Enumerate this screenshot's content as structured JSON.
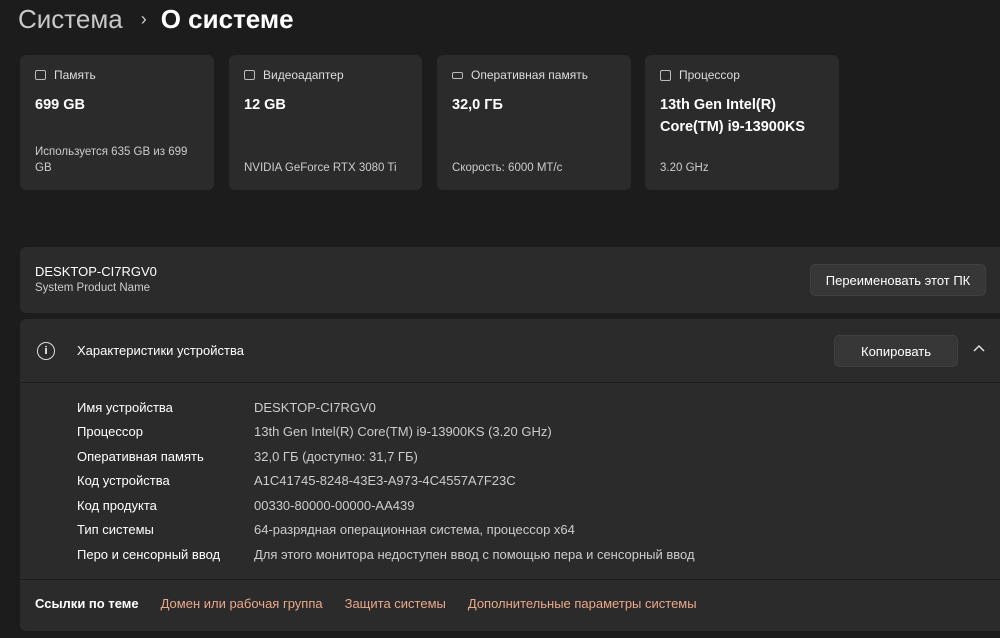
{
  "breadcrumb": {
    "parent": "Система",
    "separator": "›",
    "current": "О системе"
  },
  "cards": [
    {
      "icon": "hard-drive-icon",
      "label": "Память",
      "value": "699 GB",
      "sub": "Используется 635 GB из 699 GB"
    },
    {
      "icon": "gpu-icon",
      "label": "Видеоадаптер",
      "value": "12 GB",
      "sub": "NVIDIA GeForce RTX 3080 Ti"
    },
    {
      "icon": "ram-icon",
      "label": "Оперативная память",
      "value": "32,0 ГБ",
      "sub": "Скорость: 6000 МТ/с"
    },
    {
      "icon": "cpu-icon",
      "label": "Процессор",
      "value": "13th Gen Intel(R) Core(TM) i9-13900KS",
      "sub": "3.20 GHz"
    }
  ],
  "device": {
    "name": "DESKTOP-CI7RGV0",
    "model": "System Product Name",
    "rename_label": "Переименовать этот ПК"
  },
  "specs": {
    "title": "Характеристики устройства",
    "copy_label": "Копировать",
    "rows": [
      {
        "k": "Имя устройства",
        "v": "DESKTOP-CI7RGV0"
      },
      {
        "k": "Процессор",
        "v": "13th Gen Intel(R) Core(TM) i9-13900KS (3.20 GHz)"
      },
      {
        "k": "Оперативная память",
        "v": "32,0 ГБ (доступно: 31,7 ГБ)"
      },
      {
        "k": "Код устройства",
        "v": "A1C41745-8248-43E3-A973-4C4557A7F23C"
      },
      {
        "k": "Код продукта",
        "v": "00330-80000-00000-AA439"
      },
      {
        "k": "Тип системы",
        "v": "64-разрядная операционная система, процессор x64"
      },
      {
        "k": "Перо и сенсорный ввод",
        "v": "Для этого монитора недоступен ввод с помощью пера и сенсорный ввод"
      }
    ]
  },
  "links": {
    "title": "Ссылки по теме",
    "items": [
      "Домен или рабочая группа",
      "Защита системы",
      "Дополнительные параметры системы"
    ]
  },
  "colors": {
    "accent_link": "#e8a88c",
    "card_bg": "#2b2b2b",
    "page_bg": "#1c1c1c"
  }
}
